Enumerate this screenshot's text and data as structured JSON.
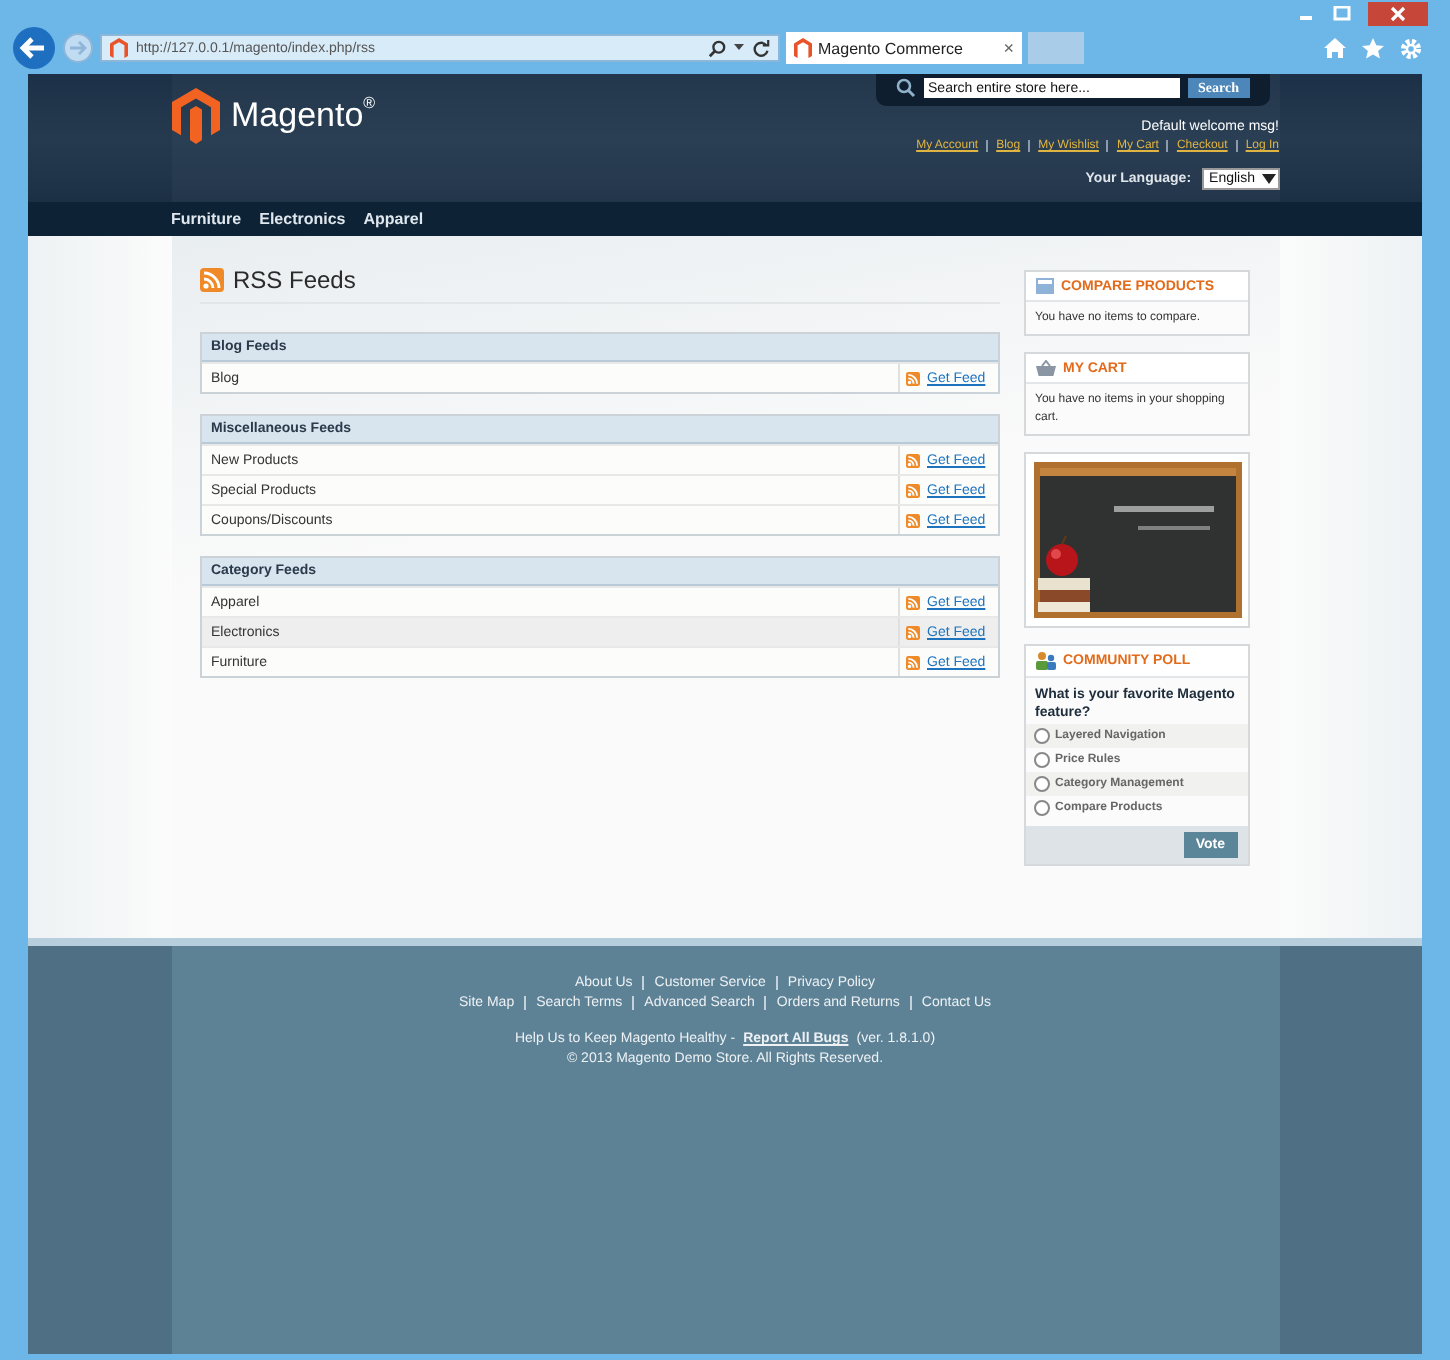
{
  "browser": {
    "url": "http://127.0.0.1/magento/index.php/rss",
    "tab_title": "Magento Commerce",
    "tab_close": "×"
  },
  "header": {
    "logo_text": "Magento",
    "logo_mark": "®",
    "search_placeholder": "Search entire store here...",
    "search_button": "Search",
    "welcome": "Default welcome msg!",
    "links": [
      "My Account",
      "Blog",
      "My Wishlist",
      "My Cart",
      "Checkout",
      "Log In"
    ],
    "language_label": "Your Language:",
    "language": "English"
  },
  "nav": [
    "Furniture",
    "Electronics",
    "Apparel"
  ],
  "page_title": "RSS Feeds",
  "feed_groups": [
    {
      "title": "Blog Feeds",
      "rows": [
        {
          "name": "Blog",
          "link": "Get Feed",
          "highlighted": false
        }
      ]
    },
    {
      "title": "Miscellaneous Feeds",
      "rows": [
        {
          "name": "New Products",
          "link": "Get Feed",
          "highlighted": false
        },
        {
          "name": "Special Products",
          "link": "Get Feed",
          "highlighted": false
        },
        {
          "name": "Coupons/Discounts",
          "link": "Get Feed",
          "highlighted": false
        }
      ]
    },
    {
      "title": "Category Feeds",
      "rows": [
        {
          "name": "Apparel",
          "link": "Get Feed",
          "highlighted": false
        },
        {
          "name": "Electronics",
          "link": "Get Feed",
          "highlighted": true
        },
        {
          "name": "Furniture",
          "link": "Get Feed",
          "highlighted": false
        }
      ]
    }
  ],
  "sidebar": {
    "compare": {
      "title": "COMPARE PRODUCTS",
      "text": "You have no items to compare."
    },
    "cart": {
      "title": "MY CART",
      "text": "You have no items in your shopping cart."
    },
    "poll": {
      "title": "COMMUNITY POLL",
      "question": "What is your favorite Magento feature?",
      "options": [
        {
          "label": "Layered Navigation",
          "selected": false
        },
        {
          "label": "Price Rules",
          "selected": false
        },
        {
          "label": "Category Management",
          "selected": false
        },
        {
          "label": "Compare Products",
          "selected": false
        }
      ],
      "button": "Vote"
    }
  },
  "footer": {
    "link_rows": [
      [
        "About Us",
        "Customer Service",
        "Privacy Policy"
      ],
      [
        "Site Map",
        "Search Terms",
        "Advanced Search",
        "Orders and Returns",
        "Contact Us"
      ]
    ],
    "help_prefix": "Help Us to Keep Magento Healthy -",
    "help_link": "Report All Bugs",
    "help_suffix": "(ver. 1.8.1.0)",
    "copyright": "© 2013 Magento Demo Store. All Rights Reserved."
  }
}
